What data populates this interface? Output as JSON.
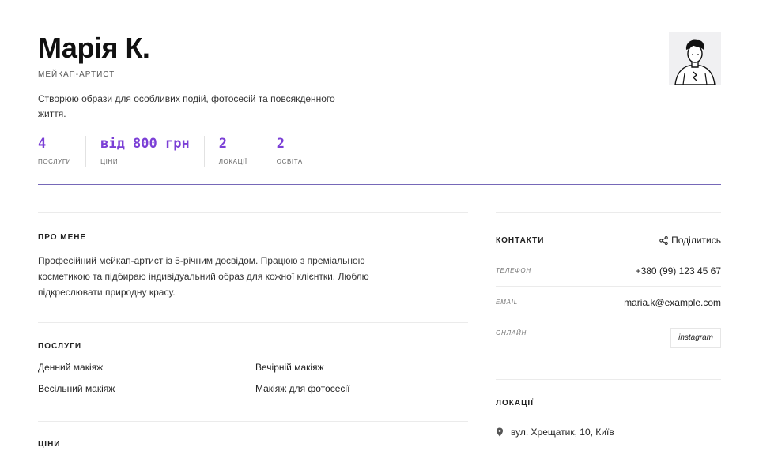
{
  "profile": {
    "name": "Марія К.",
    "role": "МЕЙКАП-АРТИСТ",
    "tagline": "Створюю образи для особливих подій, фотосесій та повсякденного життя."
  },
  "stats": [
    {
      "value": "4",
      "label": "ПОСЛУГИ"
    },
    {
      "value": "від 800 грн",
      "label": "ЦІНИ"
    },
    {
      "value": "2",
      "label": "ЛОКАЦІЇ"
    },
    {
      "value": "2",
      "label": "ОСВІТА"
    }
  ],
  "about": {
    "title": "ПРО МЕНЕ",
    "text": "Професійний мейкап-артист із 5-річним досвідом. Працюю з преміальною косметикою та підбираю індивідуальний образ для кожної клієнтки. Люблю підкреслювати природну красу."
  },
  "services": {
    "title": "ПОСЛУГИ",
    "items": [
      "Денний макіяж",
      "Вечірній макіяж",
      "Весільний макіяж",
      "Макіяж для фотосесії"
    ]
  },
  "prices": {
    "title": "ЦІНИ"
  },
  "contacts": {
    "title": "КОНТАКТИ",
    "share_label": "Поділитись",
    "phone_label": "ТЕЛЕФОН",
    "phone": "+380 (99) 123 45 67",
    "email_label": "EMAIL",
    "email": "maria.k@example.com",
    "online_label": "ОНЛАЙН",
    "instagram": "instagram"
  },
  "locations": {
    "title": "ЛОКАЦІЇ",
    "items": [
      "вул. Хрещатик, 10, Київ"
    ]
  },
  "icons": {
    "share": "share-icon",
    "location": "map-pin-icon",
    "avatar": "avatar-illustration"
  },
  "colors": {
    "accent": "#7b3fd6",
    "rule": "#7668b8"
  }
}
